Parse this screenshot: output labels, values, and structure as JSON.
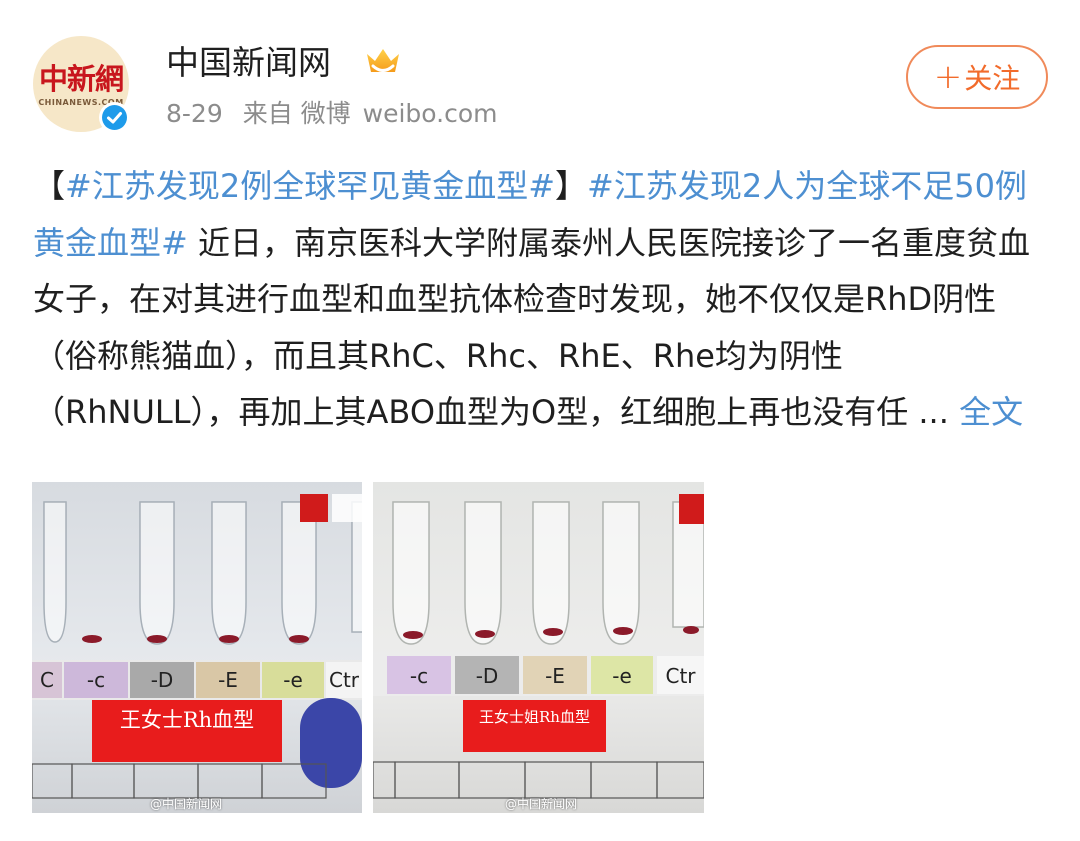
{
  "post": {
    "author": "中国新闻网",
    "avatar_text": "中新網",
    "avatar_subtext": "CHINANEWS.COM",
    "date": "8-29",
    "source_prefix": "来自 微博",
    "source_site": "weibo.com",
    "follow_label": "关注",
    "text_open_bracket": "【",
    "tag1": "#江苏发现2例全球罕见黄金血型#",
    "text_close_bracket": "】",
    "tag2": "#江苏发现2人为全球不足50例黄金血型#",
    "body": " 近日，南京医科大学附属泰州人民医院接诊了一名重度贫血女子，在对其进行血型和血型抗体检查时发现，她不仅仅是RhD阴性（俗称熊猫血），而且其RhC、Rhc、RhE、Rhe均为阴性（RhNULL），再加上其ABO血型为O型，红细胞上再也没有任 ... ",
    "more_label": "全文"
  },
  "images": [
    {
      "labels": [
        "C",
        "-c",
        "-D",
        "-E",
        "-e",
        "Ctr"
      ],
      "caption": "王女士Rh血型",
      "watermark": "@中国新闻网"
    },
    {
      "labels": [
        "-c",
        "-D",
        "-E",
        "-e",
        "Ctr"
      ],
      "caption": "王女士姐Rh血型",
      "watermark": "@中国新闻网"
    }
  ],
  "colors": {
    "link": "#4d8fd1",
    "follow": "#f26b2b",
    "verified": "#1e9bea",
    "caption_bg": "#e81c1c"
  },
  "icons": [
    "verified-badge-icon",
    "crown-badge-icon",
    "plus-icon",
    "weibo-logo-icon"
  ]
}
